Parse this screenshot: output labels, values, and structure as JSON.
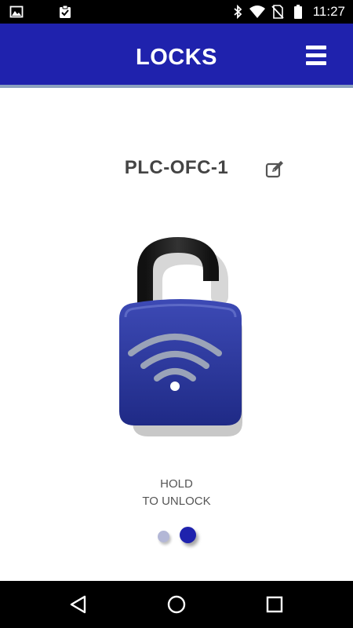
{
  "status_bar": {
    "time": "11:27",
    "icons": [
      "image-icon",
      "clipboard-check-icon",
      "bluetooth-icon",
      "wifi-icon",
      "no-sim-icon",
      "battery-icon"
    ]
  },
  "app_bar": {
    "title": "LOCKS",
    "menu_icon": "menu-icon"
  },
  "lock": {
    "name": "PLC-OFC-1",
    "edit_icon": "edit-icon",
    "state": "unlocked",
    "hold_line1": "HOLD",
    "hold_line2": "TO UNLOCK"
  },
  "pager": {
    "count": 2,
    "active_index": 1
  },
  "nav_bar": {
    "buttons": [
      "back-icon",
      "home-icon",
      "recents-icon"
    ]
  },
  "colors": {
    "brand": "#1f22ad",
    "lock_body": "#2a3596",
    "status_bar": "#000000"
  }
}
